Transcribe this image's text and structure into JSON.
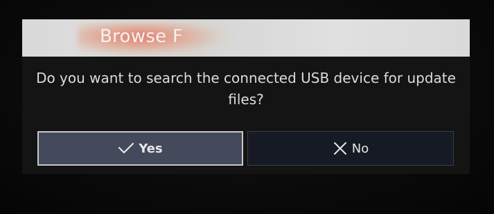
{
  "header": {
    "title": "Browse F"
  },
  "dialog": {
    "message": "Do you want to search the connected USB device for update files?"
  },
  "buttons": {
    "yes": {
      "label": "Yes",
      "icon": "checkmark-icon"
    },
    "no": {
      "label": "No",
      "icon": "close-icon"
    }
  },
  "colors": {
    "background": "#070707",
    "dialog_bg": "#141414",
    "header_bg": "#d9d9d9",
    "yes_button_bg": "#434a5b",
    "no_button_bg": "#161a24",
    "text": "#dcdcdc"
  }
}
